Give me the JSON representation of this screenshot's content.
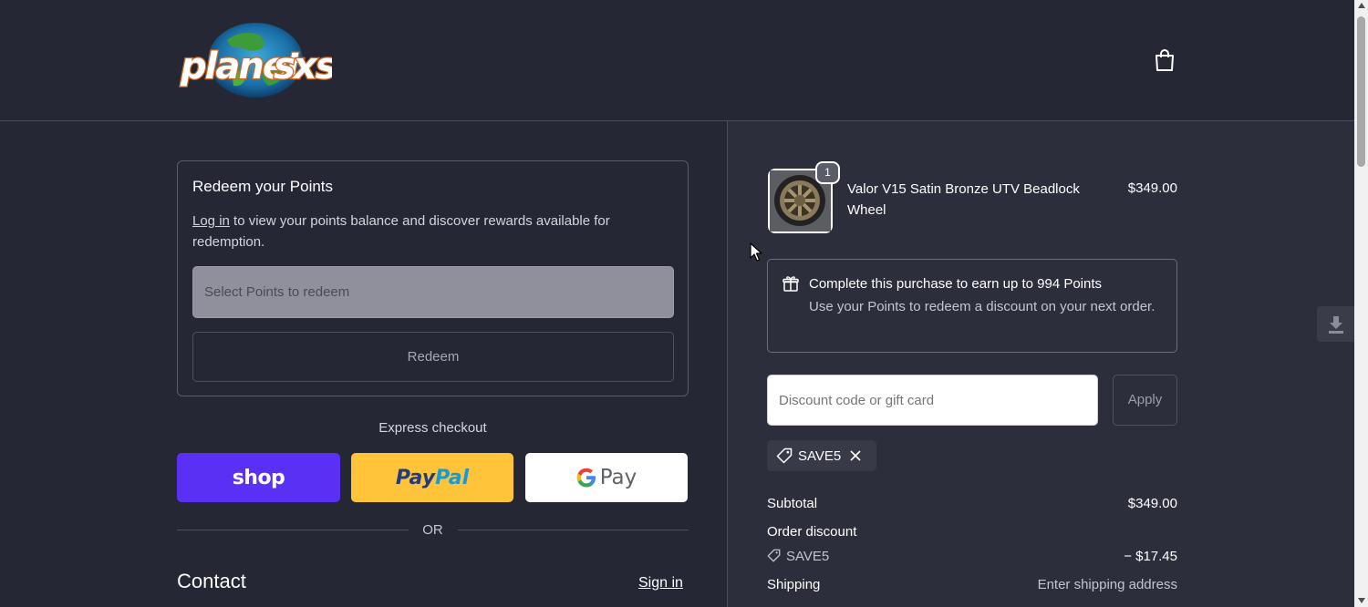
{
  "header": {
    "logo_text": "planet sxs",
    "cart_icon": "shopping-bag-icon"
  },
  "redeem": {
    "title": "Redeem your Points",
    "login_link": "Log in",
    "desc_rest": " to view your points balance and discover rewards available for redemption.",
    "select_placeholder": "Select Points to redeem",
    "button": "Redeem"
  },
  "express": {
    "label": "Express checkout",
    "shop": "shop",
    "paypal_1": "Pay",
    "paypal_2": "Pal",
    "gpay": "Pay"
  },
  "divider": {
    "or": "OR"
  },
  "contact": {
    "title": "Contact",
    "signin": "Sign in"
  },
  "order": {
    "item": {
      "name": "Valor V15 Satin Bronze UTV Beadlock Wheel",
      "price": "$349.00",
      "quantity": "1"
    },
    "earn": {
      "title": "Complete this purchase to earn up to 994 Points",
      "desc": "Use your Points to redeem a discount on your next order."
    },
    "discount": {
      "placeholder": "Discount code or gift card",
      "apply": "Apply",
      "applied_code": "SAVE5"
    },
    "summary": {
      "subtotal_label": "Subtotal",
      "subtotal_value": "$349.00",
      "order_discount_label": "Order discount",
      "discount_code": "SAVE5",
      "discount_value": "− $17.45",
      "shipping_label": "Shipping",
      "shipping_value": "Enter shipping address"
    }
  },
  "colors": {
    "bg": "#252734",
    "panel": "#2c2e3c",
    "shop_pay": "#5a31f4",
    "paypal": "#ffc439",
    "gpay": "#ffffff"
  }
}
